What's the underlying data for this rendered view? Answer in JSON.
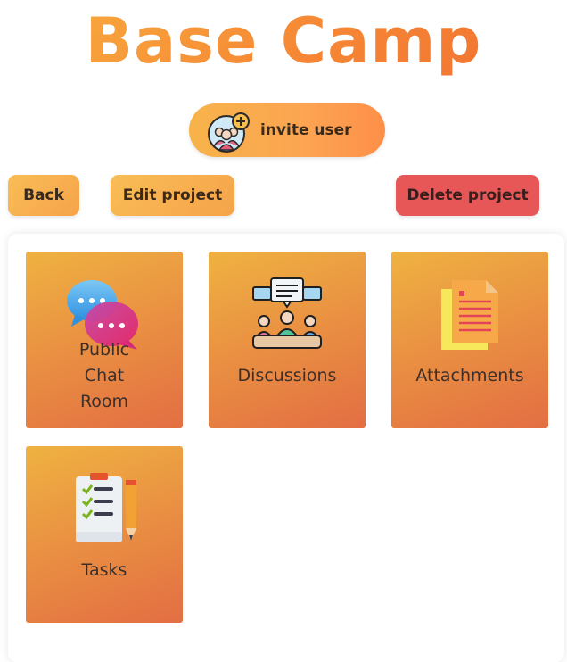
{
  "page": {
    "title": "Base Camp"
  },
  "invite": {
    "label": "invite user",
    "icon": "invite-user-icon"
  },
  "actions": {
    "back": "Back",
    "edit": "Edit project",
    "delete": "Delete project"
  },
  "tiles": [
    {
      "label": "Public Chat Room",
      "icon": "chat-bubbles-icon"
    },
    {
      "label": "Discussions",
      "icon": "discussion-meeting-icon"
    },
    {
      "label": "Attachments",
      "icon": "documents-icon"
    },
    {
      "label": "Tasks",
      "icon": "checklist-icon"
    }
  ],
  "colors": {
    "title_gradient_start": "#f8b03f",
    "title_gradient_end": "#f06f30",
    "button_orange": "#f9bd56",
    "button_red": "#e75757",
    "tile_gradient_start": "#efb241",
    "tile_gradient_end": "#e36e43"
  }
}
